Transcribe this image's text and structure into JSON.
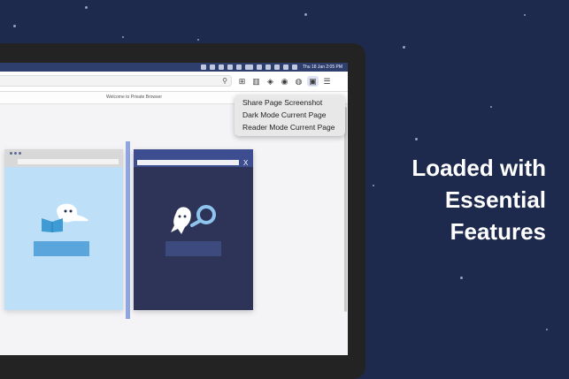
{
  "menubar": {
    "clock": "Thu 18 Jan  2:05 PM"
  },
  "browser": {
    "page_title": "Welcome to Private Browser"
  },
  "context_menu": {
    "items": [
      {
        "label": "Share Page Screenshot"
      },
      {
        "label": "Dark Mode Current Page"
      },
      {
        "label": "Reader Mode Current Page"
      }
    ]
  },
  "preview": {
    "dark_close_label": "X"
  },
  "headline": {
    "lines": [
      "Loaded with",
      "Essential",
      "Features"
    ]
  },
  "icons": [
    "search-icon",
    "add-tab-icon",
    "reader-icon",
    "extension-icon",
    "privacy-icon",
    "account-icon",
    "screenshot-icon",
    "menu-icon"
  ],
  "colors": {
    "background": "#1d2a4d",
    "menubar": "#2f3f6d",
    "accent": "#3c4e8f",
    "light_card": "#bde0f8",
    "dark_card": "#2d3458"
  }
}
